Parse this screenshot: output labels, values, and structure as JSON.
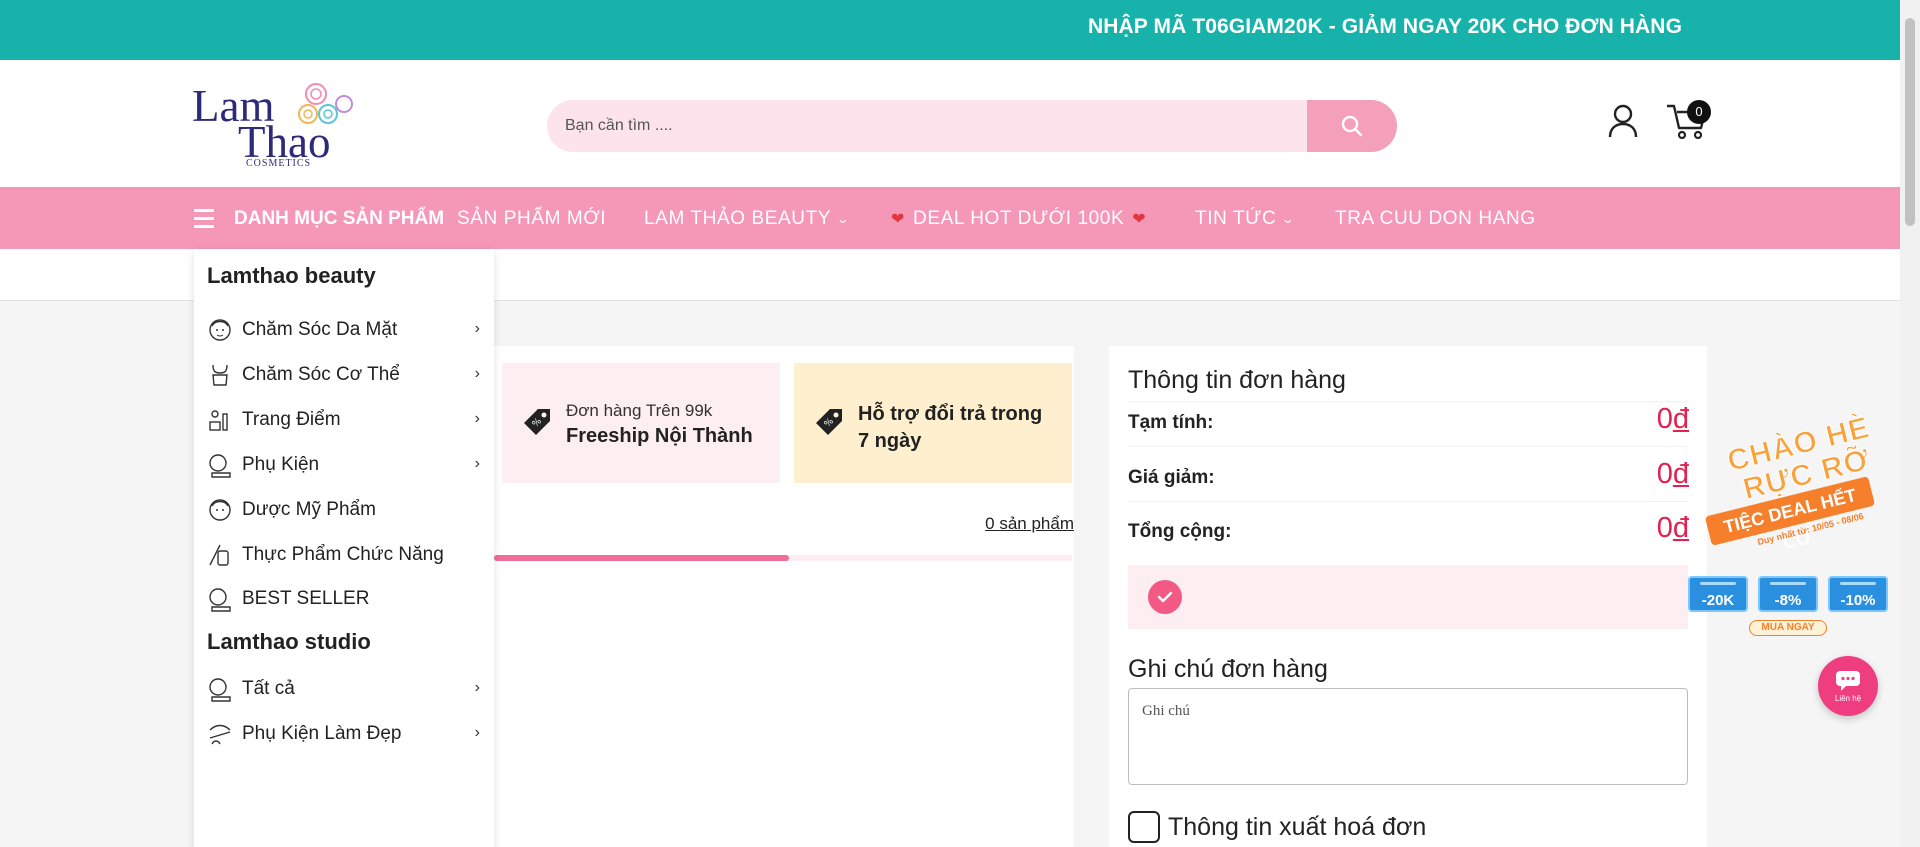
{
  "announcement": "NHẬP MÃ T06GIAM20K - GIẢM NGAY 20K CHO ĐƠN HÀNG",
  "logo": {
    "line1": "Lam",
    "line2": "Thao",
    "line3": "COSMETICS"
  },
  "search": {
    "placeholder": "Bạn cần tìm ...."
  },
  "cart": {
    "count": "0"
  },
  "nav": {
    "menu_label": "DANH MỤC SẢN PHẨM",
    "items": [
      {
        "label": "SẢN PHẨM MỚI"
      },
      {
        "label": "LAM THẢO BEAUTY"
      },
      {
        "label": "DEAL HOT DƯỚI 100K"
      },
      {
        "label": "TIN TỨC"
      },
      {
        "label": "TRA CUU DON HANG"
      }
    ]
  },
  "dropdown": {
    "group1": "Lamthao beauty",
    "items": [
      {
        "label": "Chăm Sóc Da Mặt",
        "icon": "face-care-icon"
      },
      {
        "label": "Chăm Sóc Cơ Thể",
        "icon": "body-care-icon"
      },
      {
        "label": "Trang Điểm",
        "icon": "makeup-icon"
      },
      {
        "label": "Phụ Kiện",
        "icon": "mirror-icon"
      },
      {
        "label": "Dược Mỹ Phẩm",
        "icon": "face-care-icon"
      },
      {
        "label": "Thực Phẩm Chức Năng",
        "icon": "supplement-icon"
      },
      {
        "label": "BEST SELLER",
        "icon": "mirror-icon"
      }
    ],
    "group2": "Lamthao studio",
    "studio_items": [
      {
        "label": "Tất cả",
        "icon": "mirror-icon"
      },
      {
        "label": "Phụ Kiện Làm Đẹp",
        "icon": "accessory-icon"
      }
    ]
  },
  "promos": {
    "p1_small": "Đơn hàng Trên 99k",
    "p1_big": "Freeship Nội Thành",
    "p2_text": "Hỗ trợ đổi trả trong 7 ngày"
  },
  "cart_count_text": "0 sản phẩm",
  "progress_fraction": 0.51,
  "order": {
    "title": "Thông tin đơn hàng",
    "subtotal_label": "Tạm tính:",
    "subtotal_value": "0",
    "discount_label": "Giá giảm:",
    "discount_value": "0",
    "total_label": "Tổng cộng:",
    "total_value": "0",
    "currency": "đ",
    "note_title": "Ghi chú đơn hàng",
    "note_placeholder": "Ghi chú",
    "invoice_label": "Thông tin xuất hoá đơn"
  },
  "floating_promo": {
    "line1": "CHÀO HÈ",
    "line2": "RỰC RỠ",
    "banner": "TIỆC DEAL HẾT CỠ",
    "date": "Duy nhất từ: 10/05 - 08/06",
    "coupons": [
      "-20K",
      "-8%",
      "-10%"
    ],
    "buy": "MUA NGAY"
  },
  "chat": {
    "label": "Liên hệ"
  },
  "colors": {
    "topbar": "#17b3ab",
    "nav": "#f597b6",
    "accent": "#e3204f",
    "search_bg": "#fde4ec"
  }
}
